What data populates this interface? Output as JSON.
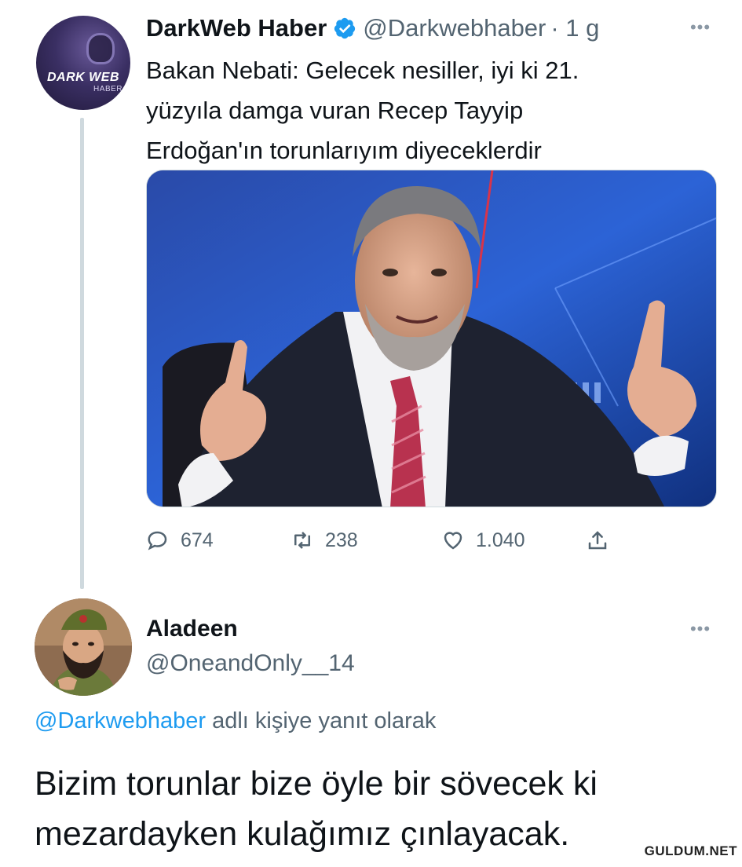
{
  "tweet": {
    "author_name": "DarkWeb Haber",
    "author_handle": "@Darkwebhaber",
    "time": "· 1 g",
    "avatar_brand": "DARK WEB",
    "avatar_subbrand": "HABER",
    "text_lines": [
      "Bakan Nebati: Gelecek nesiller, iyi ki 21.",
      "yüzyıla damga vuran  Recep Tayyip",
      "Erdoğan'ın torunlarıyım diyeceklerdir"
    ],
    "stats": {
      "replies": "674",
      "retweets": "238",
      "likes": "1.040"
    }
  },
  "reply": {
    "author_name": "Aladeen",
    "author_handle": "@OneandOnly__14",
    "replying_mention": "@Darkwebhaber",
    "replying_suffix": " adlı kişiye yanıt olarak",
    "text_lines": [
      "Bizim torunlar bize öyle bir sövecek ki",
      "mezardayken kulağımız çınlayacak."
    ]
  },
  "watermark": "GULDUM.NET",
  "colors": {
    "text": "#0f1419",
    "secondary": "#536471",
    "accent": "#1d9bf0",
    "thread_line": "#cfd9de"
  },
  "icons": [
    "verified-badge-icon",
    "more-icon",
    "reply-icon",
    "retweet-icon",
    "like-icon",
    "share-icon"
  ]
}
